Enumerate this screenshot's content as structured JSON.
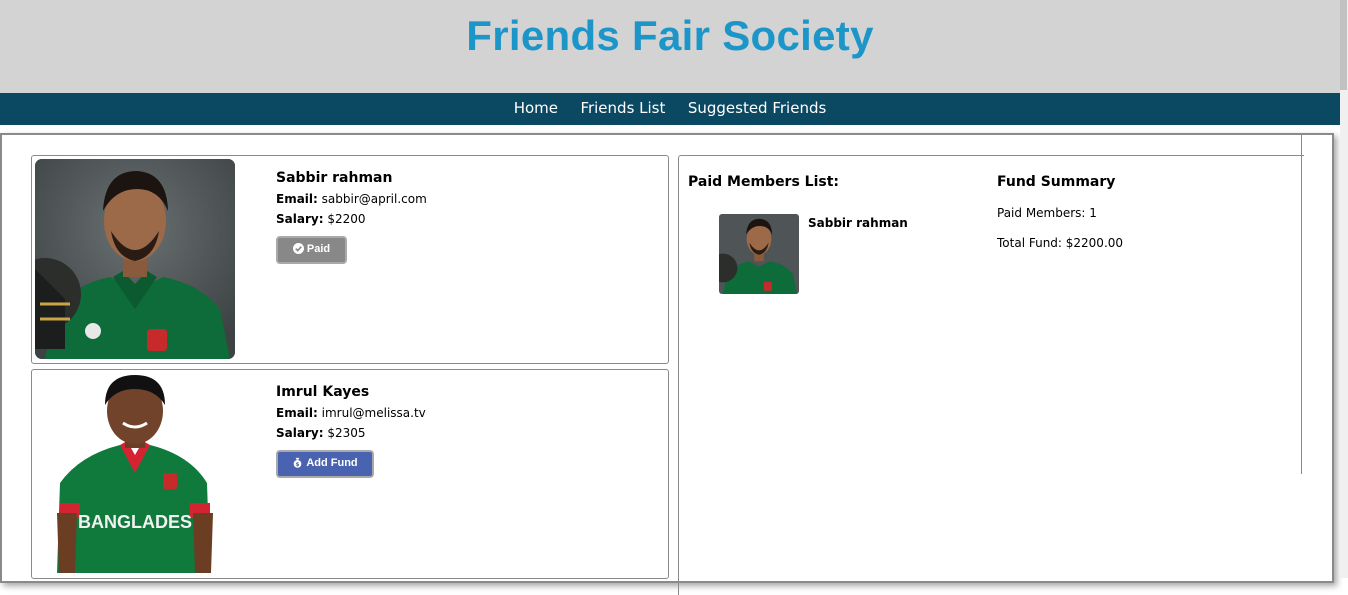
{
  "header": {
    "title": "Friends Fair Society"
  },
  "nav": {
    "items": [
      {
        "label": "Home"
      },
      {
        "label": "Friends List"
      },
      {
        "label": "Suggested Friends"
      }
    ]
  },
  "friends": [
    {
      "name": "Sabbir rahman",
      "email_label": "Email:",
      "email": "sabbir@april.com",
      "salary_label": "Salary:",
      "salary": "$2200",
      "button_label": "Paid",
      "button_icon": "check-circle-icon",
      "button_color": "#888888"
    },
    {
      "name": "Imrul Kayes",
      "email_label": "Email:",
      "email": "imrul@melissa.tv",
      "salary_label": "Salary:",
      "salary": "$2305",
      "button_label": "Add Fund",
      "button_icon": "money-bag-icon",
      "button_color": "#4a63b0"
    }
  ],
  "paid_members": {
    "title": "Paid Members List:",
    "items": [
      {
        "name": "Sabbir rahman"
      }
    ]
  },
  "fund_summary": {
    "title": "Fund Summary",
    "paid_members_text": "Paid Members: 1",
    "total_fund_text": "Total Fund: $2200.00"
  },
  "colors": {
    "title": "#1c95c9",
    "header_bg": "#d3d3d3",
    "nav_bg": "#0b4963"
  }
}
